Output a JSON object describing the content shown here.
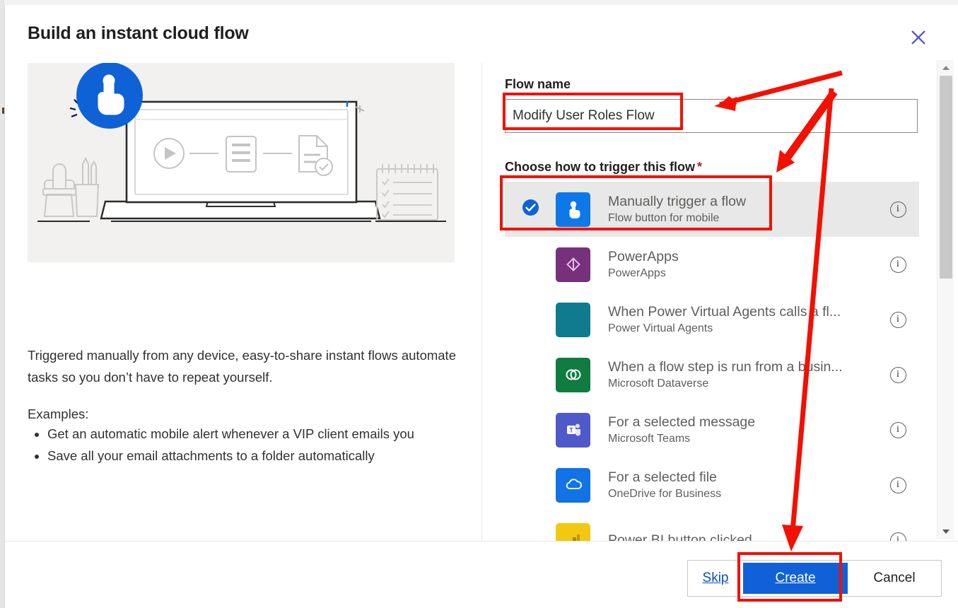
{
  "dialog": {
    "title": "Build an instant cloud flow",
    "close_icon": "close-icon"
  },
  "left_panel": {
    "illustration_name": "instant-cloud-flow-illustration",
    "description": "Triggered manually from any device, easy-to-share instant flows automate tasks so you don’t have to repeat yourself.",
    "examples_label": "Examples:",
    "examples": [
      "Get an automatic mobile alert whenever a VIP client emails you",
      "Save all your email attachments to a folder automatically"
    ]
  },
  "right_panel": {
    "flow_name_label": "Flow name",
    "flow_name_value": "Modify User Roles Flow",
    "flow_name_placeholder": "Flow name",
    "trigger_label": "Choose how to trigger this flow",
    "required_marker": "*",
    "triggers": [
      {
        "title": "Manually trigger a flow",
        "subtitle": "Flow button for mobile",
        "icon": "flow-button-mobile-icon",
        "icon_color": "#0f78e8",
        "selected": true,
        "info_label": "i"
      },
      {
        "title": "PowerApps",
        "subtitle": "PowerApps",
        "icon": "powerapps-icon",
        "icon_color": "#77307a",
        "selected": false,
        "info_label": "i"
      },
      {
        "title": "When Power Virtual Agents calls a fl...",
        "subtitle": "Power Virtual Agents",
        "icon": "power-virtual-agents-icon",
        "icon_color": "#107b8e",
        "selected": false,
        "info_label": "i"
      },
      {
        "title": "When a flow step is run from a busin...",
        "subtitle": "Microsoft Dataverse",
        "icon": "dataverse-icon",
        "icon_color": "#107c41",
        "selected": false,
        "info_label": "i"
      },
      {
        "title": "For a selected message",
        "subtitle": "Microsoft Teams",
        "icon": "microsoft-teams-icon",
        "icon_color": "#5059c9",
        "selected": false,
        "info_label": "i"
      },
      {
        "title": "For a selected file",
        "subtitle": "OneDrive for Business",
        "icon": "onedrive-icon",
        "icon_color": "#1273e6",
        "selected": false,
        "info_label": "i"
      },
      {
        "title": "Power BI button clicked",
        "subtitle": "",
        "icon": "power-bi-icon",
        "icon_color": "#f2c811",
        "selected": false,
        "info_label": "i"
      }
    ]
  },
  "footer": {
    "skip_label": "Skip",
    "create_label": "Create",
    "cancel_label": "Cancel"
  },
  "scrollbar": {
    "up_arrow": "scroll-up-arrow-icon",
    "down_arrow": "scroll-down-arrow-icon",
    "thumb": "scrollbar-thumb"
  },
  "annotations": {
    "color": "#f41000",
    "highlight_boxes": [
      "flow-name-input",
      "selected-trigger-item",
      "create-button"
    ],
    "arrows": [
      "arrow-to-flow-name",
      "arrow-to-trigger",
      "arrow-to-create"
    ]
  },
  "colors": {
    "accent_blue": "#1060d8",
    "annotation_red": "#f41000",
    "selected_row_bg": "#e8e8e8",
    "illustration_bg": "#f2f1f0"
  }
}
